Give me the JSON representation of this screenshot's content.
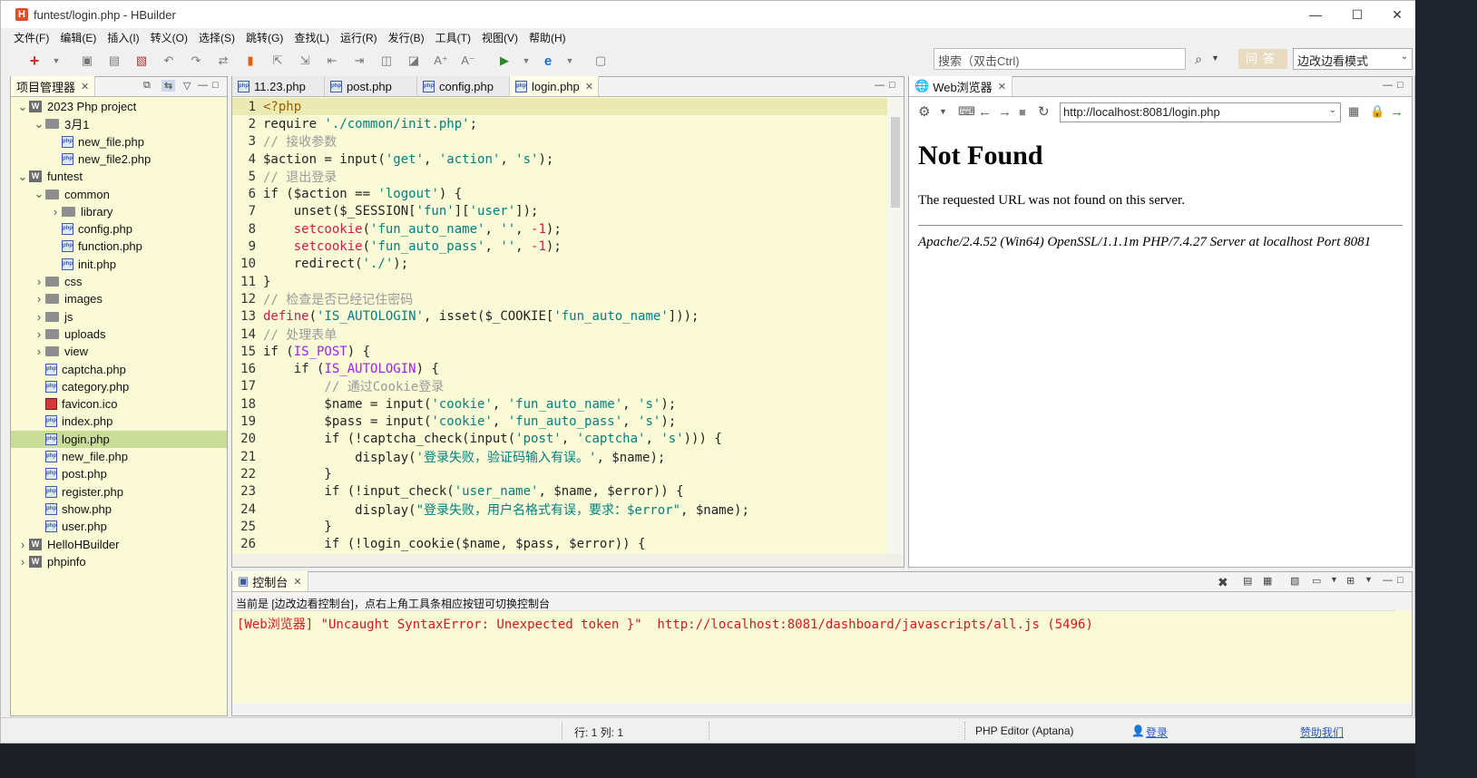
{
  "window": {
    "title": "funtest/login.php  -  HBuilder",
    "logo": "H"
  },
  "menu": [
    "文件(F)",
    "编辑(E)",
    "插入(I)",
    "转义(O)",
    "选择(S)",
    "跳转(G)",
    "查找(L)",
    "运行(R)",
    "发行(B)",
    "工具(T)",
    "视图(V)",
    "帮助(H)"
  ],
  "toolbar": {
    "search_placeholder": "搜索（双击Ctrl)",
    "ask_label": "问答",
    "mode_value": "边改边看模式"
  },
  "project": {
    "tab_label": "项目管理器",
    "tree": [
      {
        "label": "2023 Php project",
        "type": "project",
        "depth": 0,
        "expanded": true
      },
      {
        "label": "3月1",
        "type": "folder",
        "depth": 1,
        "expanded": true
      },
      {
        "label": "new_file.php",
        "type": "php",
        "depth": 2
      },
      {
        "label": "new_file2.php",
        "type": "php",
        "depth": 2
      },
      {
        "label": "funtest",
        "type": "project",
        "depth": 0,
        "expanded": true
      },
      {
        "label": "common",
        "type": "folder",
        "depth": 1,
        "expanded": true
      },
      {
        "label": "library",
        "type": "folder",
        "depth": 2,
        "expanded": false
      },
      {
        "label": "config.php",
        "type": "php",
        "depth": 2
      },
      {
        "label": "function.php",
        "type": "php",
        "depth": 2
      },
      {
        "label": "init.php",
        "type": "php",
        "depth": 2
      },
      {
        "label": "css",
        "type": "folder",
        "depth": 1,
        "expanded": false
      },
      {
        "label": "images",
        "type": "folder",
        "depth": 1,
        "expanded": false
      },
      {
        "label": "js",
        "type": "folder",
        "depth": 1,
        "expanded": false
      },
      {
        "label": "uploads",
        "type": "folder",
        "depth": 1,
        "expanded": false
      },
      {
        "label": "view",
        "type": "folder",
        "depth": 1,
        "expanded": false
      },
      {
        "label": "captcha.php",
        "type": "php",
        "depth": 1
      },
      {
        "label": "category.php",
        "type": "php",
        "depth": 1
      },
      {
        "label": "favicon.ico",
        "type": "ico",
        "depth": 1
      },
      {
        "label": "index.php",
        "type": "php",
        "depth": 1
      },
      {
        "label": "login.php",
        "type": "php",
        "depth": 1,
        "selected": true
      },
      {
        "label": "new_file.php",
        "type": "php",
        "depth": 1
      },
      {
        "label": "post.php",
        "type": "php",
        "depth": 1
      },
      {
        "label": "register.php",
        "type": "php",
        "depth": 1
      },
      {
        "label": "show.php",
        "type": "php",
        "depth": 1
      },
      {
        "label": "user.php",
        "type": "php",
        "depth": 1
      },
      {
        "label": "HelloHBuilder",
        "type": "project",
        "depth": 0,
        "expanded": false
      },
      {
        "label": "phpinfo",
        "type": "project",
        "depth": 0,
        "expanded": false
      }
    ]
  },
  "editor": {
    "tabs": [
      "11.23.php",
      "post.php",
      "config.php",
      "login.php"
    ],
    "active_tab": 3,
    "lines": [
      [
        [
          "tag",
          "<?php"
        ]
      ],
      [
        [
          "",
          "require "
        ],
        [
          "str",
          "'./common/init.php'"
        ],
        [
          "",
          ";"
        ]
      ],
      [
        [
          "cm",
          "// 接收参数"
        ]
      ],
      [
        [
          "",
          "$action = input("
        ],
        [
          "str",
          "'get'"
        ],
        [
          "",
          ", "
        ],
        [
          "str",
          "'action'"
        ],
        [
          "",
          ", "
        ],
        [
          "str",
          "'s'"
        ],
        [
          "",
          ");"
        ]
      ],
      [
        [
          "cm",
          "// 退出登录"
        ]
      ],
      [
        [
          "",
          "if ($action == "
        ],
        [
          "str",
          "'logout'"
        ],
        [
          "",
          ") {"
        ]
      ],
      [
        [
          "",
          "    unset($_SESSION["
        ],
        [
          "str",
          "'fun'"
        ],
        [
          "",
          "]["
        ],
        [
          "str",
          "'user'"
        ],
        [
          "",
          "]);"
        ]
      ],
      [
        [
          "",
          "    "
        ],
        [
          "fn",
          "setcookie"
        ],
        [
          "",
          "("
        ],
        [
          "str",
          "'fun_auto_name'"
        ],
        [
          "",
          ", "
        ],
        [
          "str",
          "''"
        ],
        [
          "",
          ", "
        ],
        [
          "fn",
          "-1"
        ],
        [
          "",
          ");"
        ]
      ],
      [
        [
          "",
          "    "
        ],
        [
          "fn",
          "setcookie"
        ],
        [
          "",
          "("
        ],
        [
          "str",
          "'fun_auto_pass'"
        ],
        [
          "",
          ", "
        ],
        [
          "str",
          "''"
        ],
        [
          "",
          ", "
        ],
        [
          "fn",
          "-1"
        ],
        [
          "",
          ");"
        ]
      ],
      [
        [
          "",
          "    redirect("
        ],
        [
          "str",
          "'./'"
        ],
        [
          "",
          ");"
        ]
      ],
      [
        [
          "",
          "}"
        ]
      ],
      [
        [
          "cm",
          "// 检查是否已经记住密码"
        ]
      ],
      [
        [
          "fn",
          "define"
        ],
        [
          "",
          "("
        ],
        [
          "str",
          "'IS_AUTOLOGIN'"
        ],
        [
          "",
          ", isset($_COOKIE["
        ],
        [
          "str",
          "'fun_auto_name'"
        ],
        [
          "",
          "]));"
        ]
      ],
      [
        [
          "cm",
          "// 处理表单"
        ]
      ],
      [
        [
          "",
          "if ("
        ],
        [
          "kw",
          "IS_POST"
        ],
        [
          "",
          ") {"
        ]
      ],
      [
        [
          "",
          "    if ("
        ],
        [
          "kw",
          "IS_AUTOLOGIN"
        ],
        [
          "",
          ") {"
        ]
      ],
      [
        [
          "cm",
          "        // 通过Cookie登录"
        ]
      ],
      [
        [
          "",
          "        $name = input("
        ],
        [
          "str",
          "'cookie'"
        ],
        [
          "",
          ", "
        ],
        [
          "str",
          "'fun_auto_name'"
        ],
        [
          "",
          ", "
        ],
        [
          "str",
          "'s'"
        ],
        [
          "",
          ");"
        ]
      ],
      [
        [
          "",
          "        $pass = input("
        ],
        [
          "str",
          "'cookie'"
        ],
        [
          "",
          ", "
        ],
        [
          "str",
          "'fun_auto_pass'"
        ],
        [
          "",
          ", "
        ],
        [
          "str",
          "'s'"
        ],
        [
          "",
          ");"
        ]
      ],
      [
        [
          "",
          "        if (!captcha_check(input("
        ],
        [
          "str",
          "'post'"
        ],
        [
          "",
          ", "
        ],
        [
          "str",
          "'captcha'"
        ],
        [
          "",
          ", "
        ],
        [
          "str",
          "'s'"
        ],
        [
          "",
          "))) {"
        ]
      ],
      [
        [
          "",
          "            display("
        ],
        [
          "str",
          "'登录失败，验证码输入有误。'"
        ],
        [
          "",
          ", $name);"
        ]
      ],
      [
        [
          "",
          "        }"
        ]
      ],
      [
        [
          "",
          "        if (!input_check("
        ],
        [
          "str",
          "'user_name'"
        ],
        [
          "",
          ", $name, $error)) {"
        ]
      ],
      [
        [
          "",
          "            display("
        ],
        [
          "str",
          "\"登录失败，用户名格式有误，要求：$error\""
        ],
        [
          "",
          ", $name);"
        ]
      ],
      [
        [
          "",
          "        }"
        ]
      ],
      [
        [
          "",
          "        if (!login_cookie($name, $pass, $error)) {"
        ]
      ]
    ]
  },
  "browser": {
    "tab_label": "Web浏览器",
    "url": "http://localhost:8081/login.php",
    "heading": "Not Found",
    "message": "The requested URL was not found on this server.",
    "server": "Apache/2.4.52 (Win64) OpenSSL/1.1.1m PHP/7.4.27 Server at localhost Port 8081"
  },
  "console": {
    "tab_label": "控制台",
    "hint": "当前是 [边改边看控制台]，点右上角工具条相应按钮可切换控制台",
    "output": "[Web浏览器] \"Uncaught SyntaxError: Unexpected token }\"  http://localhost:8081/dashboard/javascripts/all.js (5496)"
  },
  "status": {
    "position": "行: 1 列: 1",
    "editor_type": "PHP Editor (Aptana)",
    "login": "登录",
    "sponsor": "赞助我们"
  }
}
